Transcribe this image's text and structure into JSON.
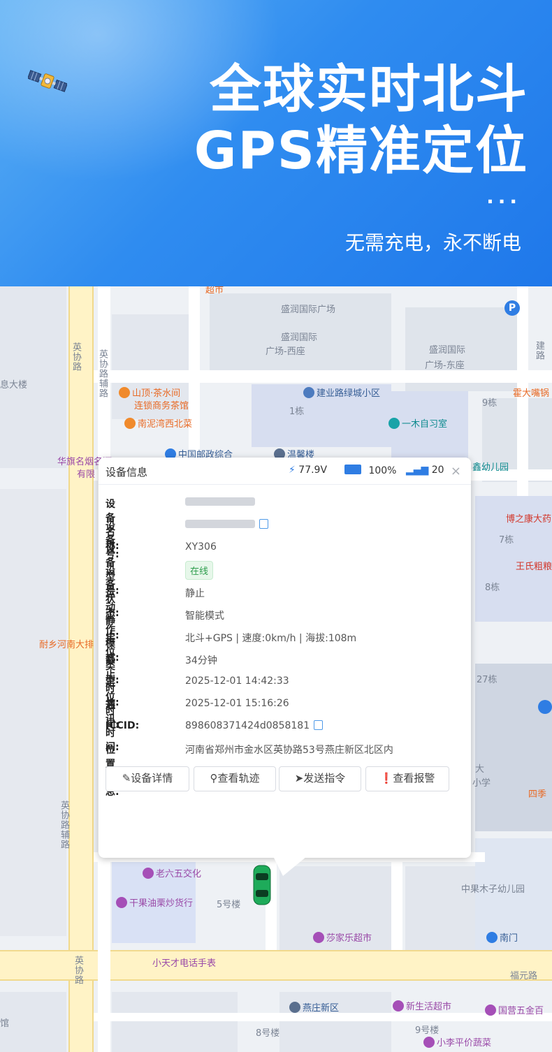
{
  "banner": {
    "headline_line1": "全球实时北斗",
    "headline_line2": "GPS精准定位",
    "dots": "···",
    "tagline": "无需充电，永不断电",
    "colors": {
      "top": "#5cb0f5",
      "bottom": "#1f78ea"
    }
  },
  "map_labels": {
    "p1": "盛润国际广场",
    "p2": "盛润国际",
    "p3": "广场-西座",
    "p4": "盛润国际",
    "p5": "广场-东座",
    "p6": "英协路",
    "p7": "英协路辅路",
    "p8": "息大楼",
    "p9": "山顶·茶水间",
    "p10": "连锁商务茶馆",
    "p11": "南泥湾西北菜",
    "p12": "建业路绿城小区",
    "p13": "1栋",
    "p14": "一木自习室",
    "p15": "9栋",
    "p16": "霍大嘴锅",
    "p17": "中国邮政综合",
    "p18": "温馨楼",
    "p19": "鑫幼儿园",
    "p20": "华旗名烟名酒",
    "p21": "有限",
    "p22": "博之康大药",
    "p23": "7栋",
    "p24": "王氏粗粮",
    "p25": "8栋",
    "p26": "耐乡河南大排",
    "p27": "27栋",
    "p28": "大",
    "p29": "小学",
    "p30": "四季",
    "p31": "英协路辅路",
    "p32": "老六五交化",
    "p33": "干果油栗炒货行",
    "p34": "5号楼",
    "p35": "中果木子幼儿园",
    "p36": "莎家乐超市",
    "p37": "南门",
    "p38": "小天才电话手表",
    "p39": "英协路",
    "p40": "福元路",
    "p41": "燕庄新区",
    "p42": "新生活超市",
    "p43": "国营五金百",
    "p44": "8号楼",
    "p45": "9号楼",
    "p46": "小李平价蔬菜",
    "p47": "馆",
    "p48": "建路",
    "p49": "超市"
  },
  "popup": {
    "title": "设备信息",
    "voltage": "77.9V",
    "battery": "100%",
    "signal": "20",
    "close": "×",
    "rows": [
      {
        "key": "设备名称:",
        "value": ""
      },
      {
        "key": "设备号:",
        "value": ""
      },
      {
        "key": "设备型号:",
        "value": "XY306"
      },
      {
        "key": "设备状态:",
        "value": "在线"
      },
      {
        "key": "运动静止:",
        "value": "静止"
      },
      {
        "key": "工作模式:",
        "value": "智能模式"
      },
      {
        "key": "定位类型:",
        "value": "北斗+GPS | 速度:0km/h | 海拔:108m"
      },
      {
        "key": "静止时长:",
        "value": "34分钟"
      },
      {
        "key": "定位时间:",
        "value": "2025-12-01 14:42:33"
      },
      {
        "key": "通讯时间:",
        "value": "2025-12-01 15:16:26"
      },
      {
        "key": "ICCID:",
        "value": "898608371424d0858181"
      },
      {
        "key": "位置信息:",
        "value": "河南省郑州市金水区英协路53号燕庄新区北区内"
      }
    ],
    "buttons": [
      {
        "icon": "edit-icon",
        "label": "设备详情"
      },
      {
        "icon": "location-pin-icon",
        "label": "查看轨迹"
      },
      {
        "icon": "send-icon",
        "label": "发送指令"
      },
      {
        "icon": "alert-icon",
        "label": "查看报警"
      }
    ],
    "colors": {
      "online_tag": "#2e9e4d",
      "link": "#4f9ae8"
    }
  }
}
